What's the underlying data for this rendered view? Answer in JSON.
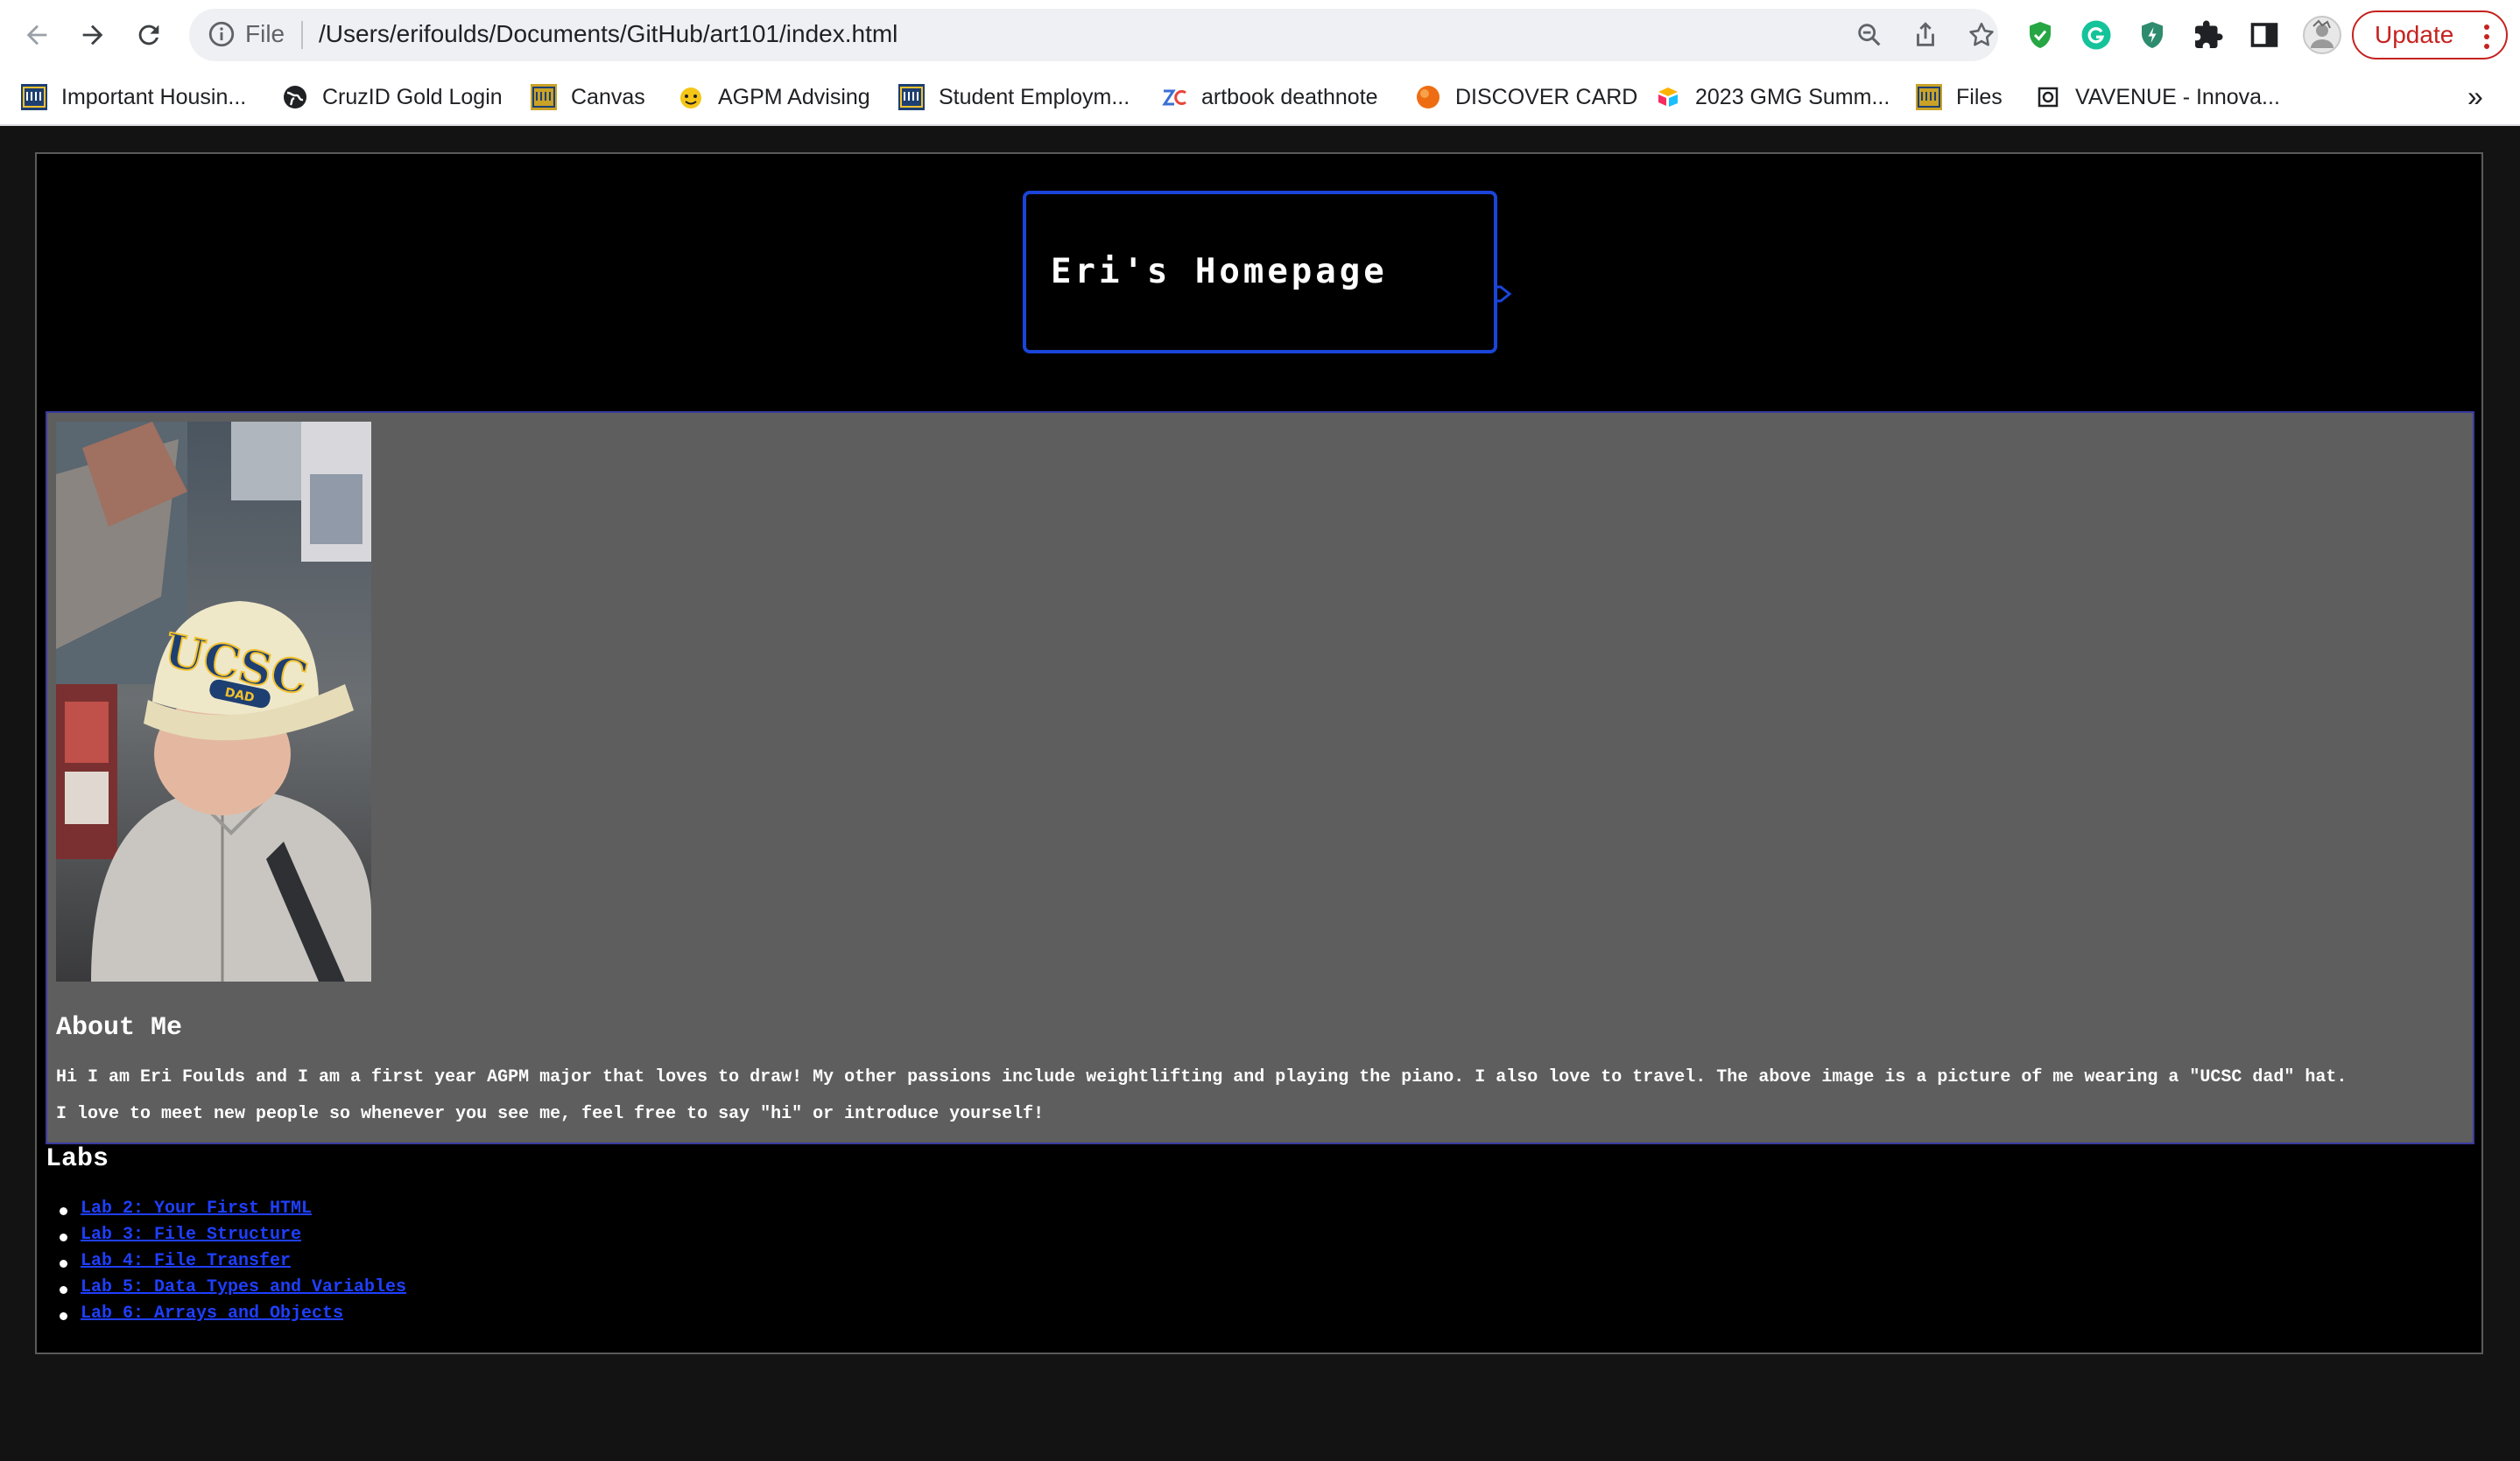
{
  "browser": {
    "url_scheme": "File",
    "url": "/Users/erifoulds/Documents/GitHub/art101/index.html",
    "update_label": "Update",
    "more_bookmarks": "»",
    "bookmarks": [
      {
        "label": "Important Housin...",
        "icon": "ucsc-icon"
      },
      {
        "label": "CruzID Gold Login",
        "icon": "globe-icon"
      },
      {
        "label": "Canvas",
        "icon": "ucsc-icon"
      },
      {
        "label": "AGPM Advising",
        "icon": "emoji-icon"
      },
      {
        "label": "Student Employm...",
        "icon": "ucsc-icon"
      },
      {
        "label": "artbook deathnote",
        "icon": "zc-icon"
      },
      {
        "label": "DISCOVER CARD",
        "icon": "discover-icon"
      },
      {
        "label": "2023 GMG Summ...",
        "icon": "airtable-icon"
      },
      {
        "label": "Files",
        "icon": "ucsc-icon"
      },
      {
        "label": "VAVENUE - Innova...",
        "icon": "vavenue-icon"
      }
    ]
  },
  "page": {
    "title": "Eri's Homepage",
    "about": {
      "heading": "About Me",
      "line1": "Hi I am Eri Foulds and I am a first year AGPM major that loves to draw! My other passions include weightlifting and playing the piano. I also love to travel. The above image is a picture of me wearing a \"UCSC dad\" hat.",
      "line2": "I love to meet new people so whenever you see me, feel free to say \"hi\" or introduce yourself!",
      "photo_hat_text": "UCSC",
      "photo_badge_text": "DAD"
    },
    "labs": {
      "heading": "Labs",
      "items": [
        "Lab 2: Your First HTML",
        "Lab 3: File Structure",
        "Lab 4: File Transfer",
        "Lab 5: Data Types and Variables",
        "Lab 6: Arrays and Objects"
      ]
    }
  },
  "colors": {
    "accent_blue": "#1b44d8",
    "link": "#1f3fff",
    "about_bg": "#5e5e5e",
    "update_red": "#c5221f"
  }
}
